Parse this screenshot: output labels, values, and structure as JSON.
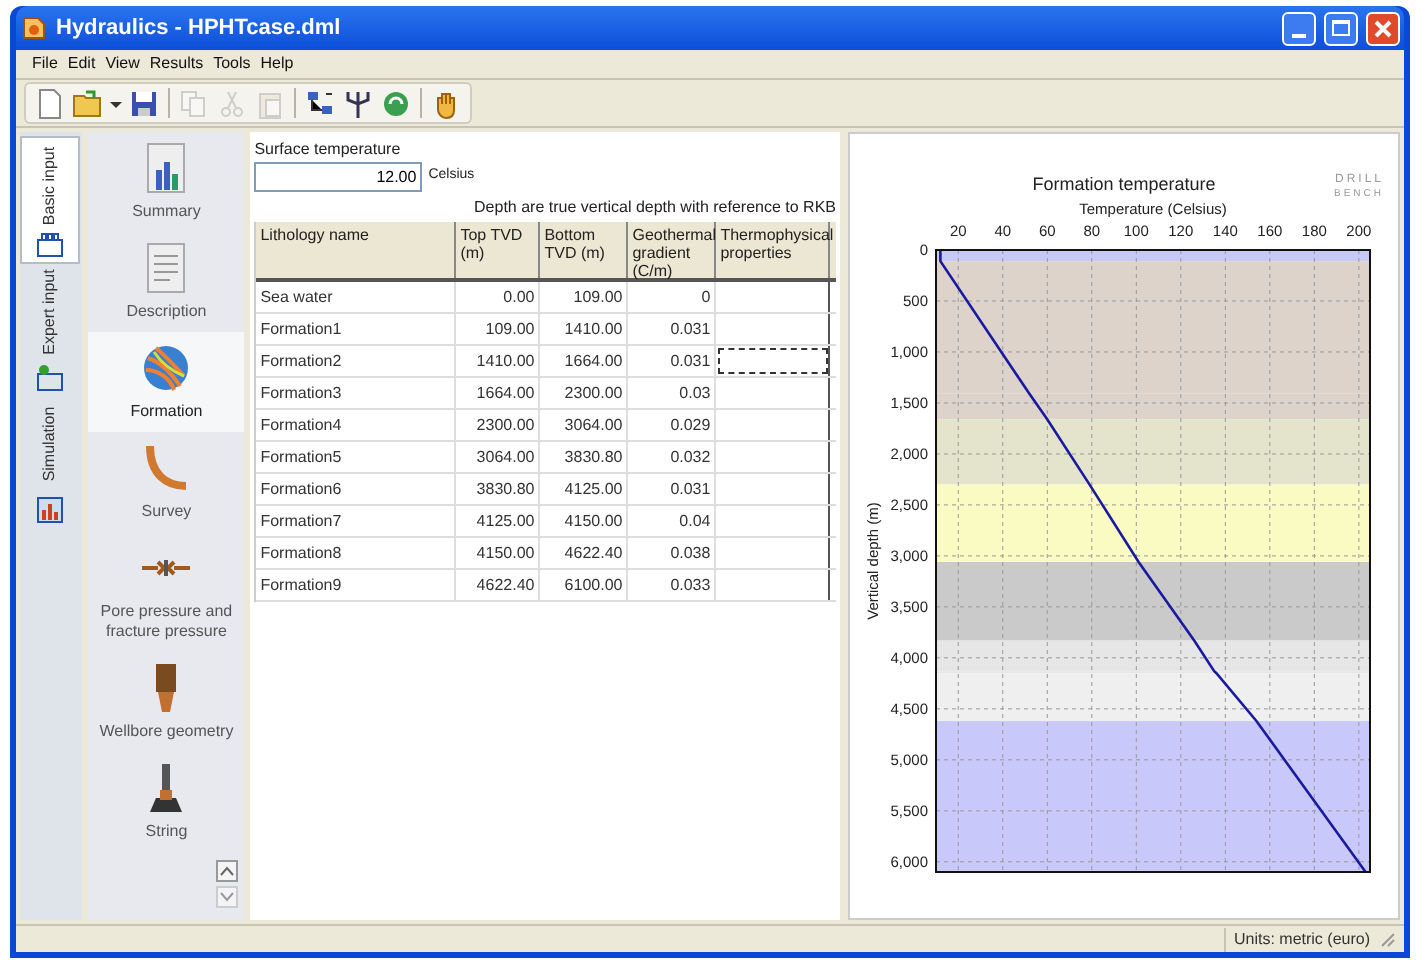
{
  "window": {
    "title": "Hydraulics - HPHTcase.dml"
  },
  "menu": [
    "File",
    "Edit",
    "View",
    "Results",
    "Tools",
    "Help"
  ],
  "toolbar": [
    {
      "kind": "new",
      "disabled": false
    },
    {
      "kind": "open",
      "disabled": false
    },
    {
      "kind": "dropdown",
      "disabled": false
    },
    {
      "kind": "save",
      "disabled": false
    },
    {
      "kind": "sep"
    },
    {
      "kind": "copy",
      "disabled": true
    },
    {
      "kind": "cut",
      "disabled": true
    },
    {
      "kind": "paste",
      "disabled": true
    },
    {
      "kind": "sep"
    },
    {
      "kind": "network",
      "disabled": false
    },
    {
      "kind": "fork",
      "disabled": false
    },
    {
      "kind": "refresh",
      "disabled": false
    },
    {
      "kind": "sep"
    },
    {
      "kind": "hand",
      "disabled": false
    }
  ],
  "side_tabs": [
    {
      "label": "Basic input",
      "selected": true
    },
    {
      "label": "Expert input",
      "selected": false
    },
    {
      "label": "Simulation",
      "selected": false
    }
  ],
  "nav": [
    {
      "label": "Summary",
      "kind": "summary",
      "selected": false
    },
    {
      "label": "Description",
      "kind": "description",
      "selected": false
    },
    {
      "label": "Formation",
      "kind": "formation",
      "selected": true
    },
    {
      "label": "Survey",
      "kind": "survey",
      "selected": false
    },
    {
      "label": "Pore pressure and fracture pressure",
      "kind": "pressure",
      "selected": false
    },
    {
      "label": "Wellbore geometry",
      "kind": "wellbore",
      "selected": false
    },
    {
      "label": "String",
      "kind": "string",
      "selected": false
    }
  ],
  "surface_temperature": {
    "label": "Surface temperature",
    "value": "12.00",
    "unit": "Celsius"
  },
  "note": "Depth are true vertical depth with reference to RKB",
  "table": {
    "columns": [
      "Lithology name",
      "Top TVD (m)",
      "Bottom TVD (m)",
      "Geothermal gradient (C/m)",
      "Thermophysical properties"
    ],
    "rows": [
      {
        "cells": [
          "Sea water",
          "0.00",
          "109.00",
          "0",
          ""
        ],
        "focused": false
      },
      {
        "cells": [
          "Formation1",
          "109.00",
          "1410.00",
          "0.031",
          ""
        ],
        "focused": false
      },
      {
        "cells": [
          "Formation2",
          "1410.00",
          "1664.00",
          "0.031",
          ""
        ],
        "focused": true
      },
      {
        "cells": [
          "Formation3",
          "1664.00",
          "2300.00",
          "0.03",
          ""
        ],
        "focused": false
      },
      {
        "cells": [
          "Formation4",
          "2300.00",
          "3064.00",
          "0.029",
          ""
        ],
        "focused": false
      },
      {
        "cells": [
          "Formation5",
          "3064.00",
          "3830.80",
          "0.032",
          ""
        ],
        "focused": false
      },
      {
        "cells": [
          "Formation6",
          "3830.80",
          "4125.00",
          "0.031",
          ""
        ],
        "focused": false
      },
      {
        "cells": [
          "Formation7",
          "4125.00",
          "4150.00",
          "0.04",
          ""
        ],
        "focused": false
      },
      {
        "cells": [
          "Formation8",
          "4150.00",
          "4622.40",
          "0.038",
          ""
        ],
        "focused": false
      },
      {
        "cells": [
          "Formation9",
          "4622.40",
          "6100.00",
          "0.033",
          ""
        ],
        "focused": false
      }
    ]
  },
  "chart": {
    "logo": [
      "DRILL",
      "BENCH"
    ],
    "chart_data": {
      "type": "line",
      "title": "Formation temperature",
      "xlabel": "Temperature (Celsius)",
      "ylabel": "Vertical depth (m)",
      "x": [
        12,
        12,
        52,
        60,
        79,
        101,
        126,
        135,
        136,
        154,
        203
      ],
      "series": [
        {
          "color": "#1a1aa0",
          "values": [
            0,
            110,
            1410,
            1660,
            2300,
            3060,
            3830,
            4130,
            4150,
            4620,
            6100
          ]
        }
      ],
      "grid": true,
      "xlim": [
        10,
        205
      ],
      "ylim": [
        6100,
        0
      ],
      "xticks": [
        20,
        40,
        60,
        80,
        100,
        120,
        140,
        160,
        180,
        200
      ],
      "yticks": [
        0,
        500,
        {
          "value": 1000,
          "label": "1,000"
        },
        {
          "value": 1500,
          "label": "1,500"
        },
        {
          "value": 2000,
          "label": "2,000"
        },
        {
          "value": 2500,
          "label": "2,500"
        },
        {
          "value": 3000,
          "label": "3,000"
        },
        {
          "value": 3500,
          "label": "3,500"
        },
        {
          "value": 4000,
          "label": "4,000"
        },
        {
          "value": 4500,
          "label": "4,500"
        },
        {
          "value": 5000,
          "label": "5,000"
        },
        {
          "value": 5500,
          "label": "5,500"
        },
        {
          "value": 6000,
          "label": "6,000"
        }
      ],
      "bands": [
        {
          "axis": "y",
          "from": 0,
          "to": 110,
          "color": "#c8c8f5"
        },
        {
          "axis": "y",
          "from": 110,
          "to": 1410,
          "color": "#ddd3cb"
        },
        {
          "axis": "y",
          "from": 1410,
          "to": 1660,
          "color": "#ddd3cb"
        },
        {
          "axis": "y",
          "from": 1660,
          "to": 2300,
          "color": "#e4e4cc"
        },
        {
          "axis": "y",
          "from": 2300,
          "to": 3060,
          "color": "#fafac3"
        },
        {
          "axis": "y",
          "from": 3060,
          "to": 3830,
          "color": "#cacaca"
        },
        {
          "axis": "y",
          "from": 3830,
          "to": 4130,
          "color": "#e6e6e6"
        },
        {
          "axis": "y",
          "from": 4130,
          "to": 4150,
          "color": "#e6e6e6"
        },
        {
          "axis": "y",
          "from": 4150,
          "to": 4620,
          "color": "#efefef"
        },
        {
          "axis": "y",
          "from": 4620,
          "to": 6100,
          "color": "#c8c8fa"
        }
      ]
    }
  },
  "status_bar": {
    "units": "Units: metric (euro)"
  }
}
